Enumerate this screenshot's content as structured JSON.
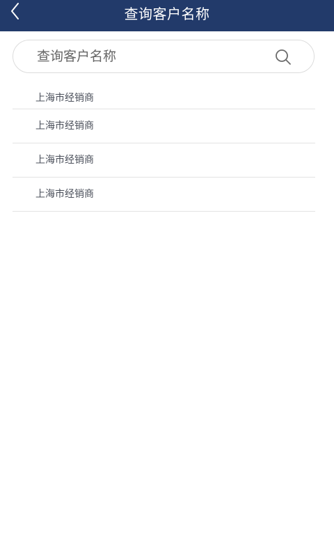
{
  "header": {
    "title": "查询客户名称"
  },
  "search": {
    "placeholder": "查询客户名称",
    "value": ""
  },
  "results": {
    "items": [
      {
        "label": "上海市经销商"
      },
      {
        "label": "上海市经销商"
      },
      {
        "label": "上海市经销商"
      },
      {
        "label": "上海市经销商"
      }
    ]
  },
  "colors": {
    "header_bg": "#223a6a",
    "header_text": "#ffffff",
    "item_text": "#4a4f5a",
    "divider": "#e3e3e3"
  },
  "icons": {
    "back": "chevron-left-icon",
    "search": "search-icon"
  }
}
